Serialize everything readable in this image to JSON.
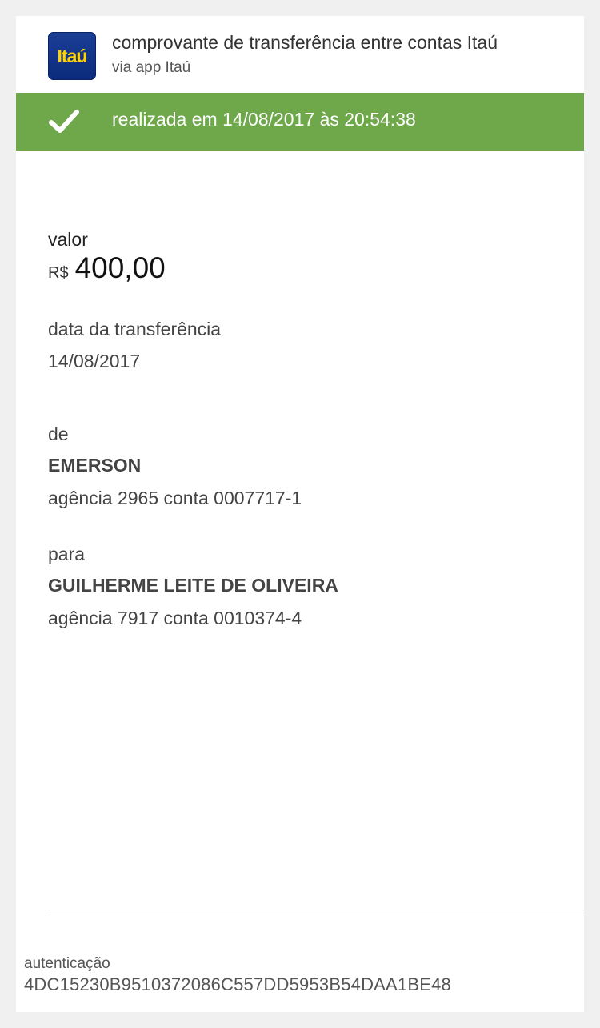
{
  "header": {
    "logo_text": "Itaú",
    "title": "comprovante de transferência entre contas Itaú",
    "subtitle": "via app Itaú"
  },
  "status": {
    "icon": "checkmark-icon",
    "text": "realizada em 14/08/2017 às 20:54:38",
    "color": "#6fa84a"
  },
  "valor": {
    "label": "valor",
    "currency": "R$",
    "amount": "400,00"
  },
  "data_transferencia": {
    "label": "data da transferência",
    "value": "14/08/2017"
  },
  "de": {
    "label": "de",
    "name": "EMERSON",
    "account": "agência 2965 conta 0007717-1"
  },
  "para": {
    "label": "para",
    "name": "GUILHERME LEITE DE OLIVEIRA",
    "account": "agência 7917 conta 0010374-4"
  },
  "autenticacao": {
    "label": "autenticação",
    "code": "4DC15230B9510372086C557DD5953B54DAA1BE48"
  }
}
